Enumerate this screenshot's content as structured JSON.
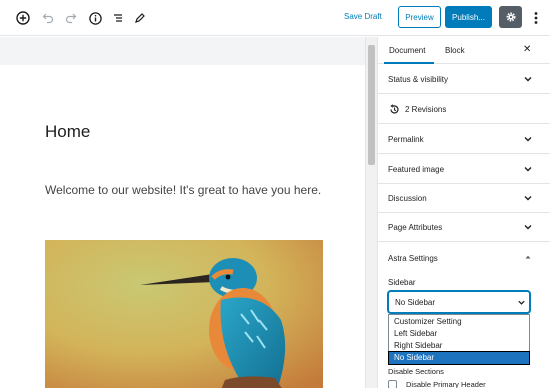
{
  "toolbar": {
    "save_draft": "Save Draft",
    "preview": "Preview",
    "publish": "Publish...",
    "icons": [
      "add-block-icon",
      "undo-icon",
      "redo-icon",
      "info-icon",
      "list-view-icon",
      "edit-icon",
      "gear-icon",
      "more-options-icon"
    ]
  },
  "editor": {
    "title": "Home",
    "paragraph": "Welcome to our website! It's great to have you here."
  },
  "sidebar": {
    "tabs": [
      {
        "label": "Document"
      },
      {
        "label": "Block"
      }
    ],
    "panels": [
      {
        "label": "Status & visibility"
      },
      {
        "label": "2 Revisions"
      },
      {
        "label": "Permalink"
      },
      {
        "label": "Featured image"
      },
      {
        "label": "Discussion"
      },
      {
        "label": "Page Attributes"
      },
      {
        "label": "Astra Settings"
      }
    ],
    "astra": {
      "sidebar_label": "Sidebar",
      "selected_value": "No Sidebar",
      "options": [
        "Customizer Setting",
        "Left Sidebar",
        "Right Sidebar",
        "No Sidebar"
      ],
      "disable_sections_label": "Disable Sections",
      "disable_primary_header": "Disable Primary Header"
    }
  },
  "colors": {
    "accent": "#007cba",
    "gear_bg": "#555d66",
    "option_selected": "#1e73be"
  }
}
